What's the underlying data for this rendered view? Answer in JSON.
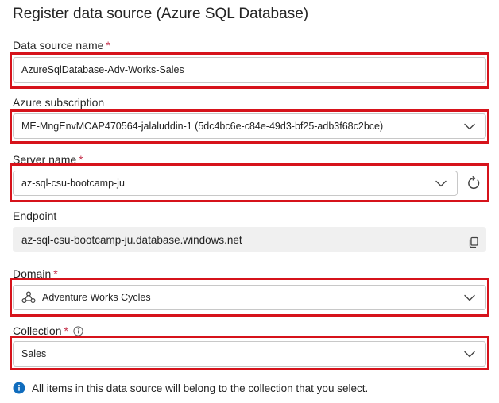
{
  "title": "Register data source (Azure SQL Database)",
  "required_mark": "*",
  "data_source_name": {
    "label": "Data source name",
    "value": "AzureSqlDatabase-Adv-Works-Sales"
  },
  "azure_subscription": {
    "label": "Azure subscription",
    "value": "ME-MngEnvMCAP470564-jalaluddin-1 (5dc4bc6e-c84e-49d3-bf25-adb3f68c2bce)"
  },
  "server_name": {
    "label": "Server name",
    "value": "az-sql-csu-bootcamp-ju"
  },
  "endpoint": {
    "label": "Endpoint",
    "value": "az-sql-csu-bootcamp-ju.database.windows.net"
  },
  "domain": {
    "label": "Domain",
    "value": "Adventure Works Cycles"
  },
  "collection": {
    "label": "Collection",
    "value": "Sales"
  },
  "info_message": "All items in this data source will belong to the collection that you select.",
  "icons": {
    "dropdown": "chevron-down-icon",
    "refresh": "refresh-icon",
    "copy": "copy-icon",
    "domain": "domain-icon",
    "info_outline": "info-outline-icon",
    "info_filled": "info-filled-icon"
  },
  "colors": {
    "highlight": "#d6131b",
    "required": "#c4314b",
    "info": "#0f6cbd"
  }
}
